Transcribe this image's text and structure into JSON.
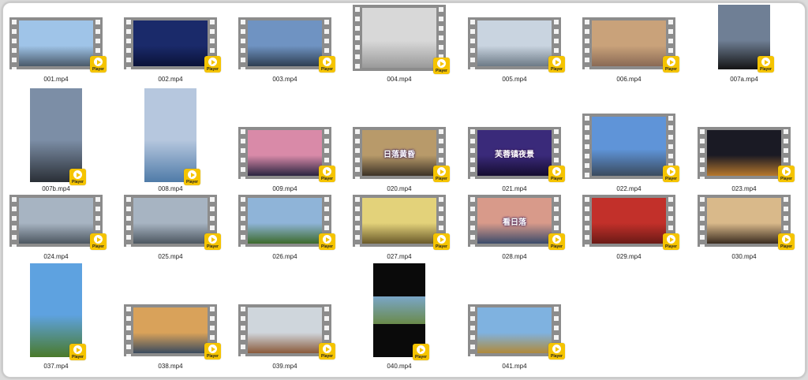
{
  "player_badge_label": "Player",
  "files": [
    {
      "name": "001.mp4",
      "orientation": "landscape",
      "overlay": "",
      "colors": {
        "sky": "#9fc4e8",
        "ground": "#4a5a6a"
      }
    },
    {
      "name": "002.mp4",
      "orientation": "landscape",
      "overlay": "",
      "colors": {
        "sky": "#1a2a6a",
        "ground": "#0a1238"
      }
    },
    {
      "name": "003.mp4",
      "orientation": "landscape",
      "overlay": "",
      "colors": {
        "sky": "#6f93c2",
        "ground": "#2e3e52"
      }
    },
    {
      "name": "004.mp4",
      "orientation": "landscape",
      "overlay": "",
      "colors": {
        "sky": "#d8d8d8",
        "ground": "#9a9a9a"
      }
    },
    {
      "name": "005.mp4",
      "orientation": "landscape",
      "overlay": "",
      "colors": {
        "sky": "#c9d4e0",
        "ground": "#6d7a86"
      }
    },
    {
      "name": "006.mp4",
      "orientation": "landscape",
      "overlay": "",
      "colors": {
        "sky": "#c9a27a",
        "ground": "#8a6a55"
      }
    },
    {
      "name": "007a.mp4",
      "orientation": "portrait",
      "overlay": "",
      "colors": {
        "sky": "#6f7f95",
        "ground": "#141414"
      }
    },
    {
      "name": "007b.mp4",
      "orientation": "portrait",
      "overlay": "",
      "colors": {
        "sky": "#7c8ea6",
        "ground": "#2a2f36"
      }
    },
    {
      "name": "008.mp4",
      "orientation": "portrait",
      "overlay": "",
      "colors": {
        "sky": "#b6c7de",
        "ground": "#4f7ba8"
      }
    },
    {
      "name": "009.mp4",
      "orientation": "landscape",
      "overlay": "",
      "colors": {
        "sky": "#d98aa8",
        "ground": "#2a2440"
      }
    },
    {
      "name": "020.mp4",
      "orientation": "landscape",
      "overlay": "日落黄昏",
      "colors": {
        "sky": "#b89a6a",
        "ground": "#3c3226"
      }
    },
    {
      "name": "021.mp4",
      "orientation": "landscape",
      "overlay": "芙蓉镇夜景",
      "colors": {
        "sky": "#3a2a7a",
        "ground": "#150c30"
      }
    },
    {
      "name": "022.mp4",
      "orientation": "landscape",
      "overlay": "",
      "colors": {
        "sky": "#5f94d8",
        "ground": "#3a4a5e"
      }
    },
    {
      "name": "023.mp4",
      "orientation": "landscape",
      "overlay": "",
      "colors": {
        "sky": "#1a1a24",
        "ground": "#b7782c"
      }
    },
    {
      "name": "024.mp4",
      "orientation": "landscape",
      "overlay": "",
      "colors": {
        "sky": "#a7b4c2",
        "ground": "#4c5660"
      }
    },
    {
      "name": "025.mp4",
      "orientation": "landscape",
      "overlay": "",
      "colors": {
        "sky": "#a7b4c2",
        "ground": "#4c5660"
      }
    },
    {
      "name": "026.mp4",
      "orientation": "landscape",
      "overlay": "",
      "colors": {
        "sky": "#8fb4d8",
        "ground": "#3c6a2c"
      }
    },
    {
      "name": "027.mp4",
      "orientation": "landscape",
      "overlay": "",
      "colors": {
        "sky": "#e3d27a",
        "ground": "#6a5a2a"
      }
    },
    {
      "name": "028.mp4",
      "orientation": "landscape",
      "overlay": "看日落",
      "colors": {
        "sky": "#d89a8a",
        "ground": "#3a4a6a"
      }
    },
    {
      "name": "029.mp4",
      "orientation": "landscape",
      "overlay": "",
      "colors": {
        "sky": "#c2302a",
        "ground": "#6a1a16"
      }
    },
    {
      "name": "030.mp4",
      "orientation": "landscape",
      "overlay": "",
      "colors": {
        "sky": "#d9b98a",
        "ground": "#3a2c20"
      }
    },
    {
      "name": "037.mp4",
      "orientation": "portrait",
      "overlay": "",
      "colors": {
        "sky": "#5ea2e0",
        "ground": "#4a7a2a"
      }
    },
    {
      "name": "038.mp4",
      "orientation": "landscape",
      "overlay": "",
      "colors": {
        "sky": "#d9a25a",
        "ground": "#3a4a5e"
      }
    },
    {
      "name": "039.mp4",
      "orientation": "landscape",
      "overlay": "",
      "colors": {
        "sky": "#cfd6dc",
        "ground": "#8a5a3a"
      }
    },
    {
      "name": "040.mp4",
      "orientation": "portrait",
      "overlay": "",
      "colors": {
        "sky": "#0a0a0a",
        "ground": "#0a0a0a",
        "band": "#7aa6c8"
      }
    },
    {
      "name": "041.mp4",
      "orientation": "landscape",
      "overlay": "",
      "colors": {
        "sky": "#7fb2e0",
        "ground": "#b08a3a"
      }
    }
  ]
}
